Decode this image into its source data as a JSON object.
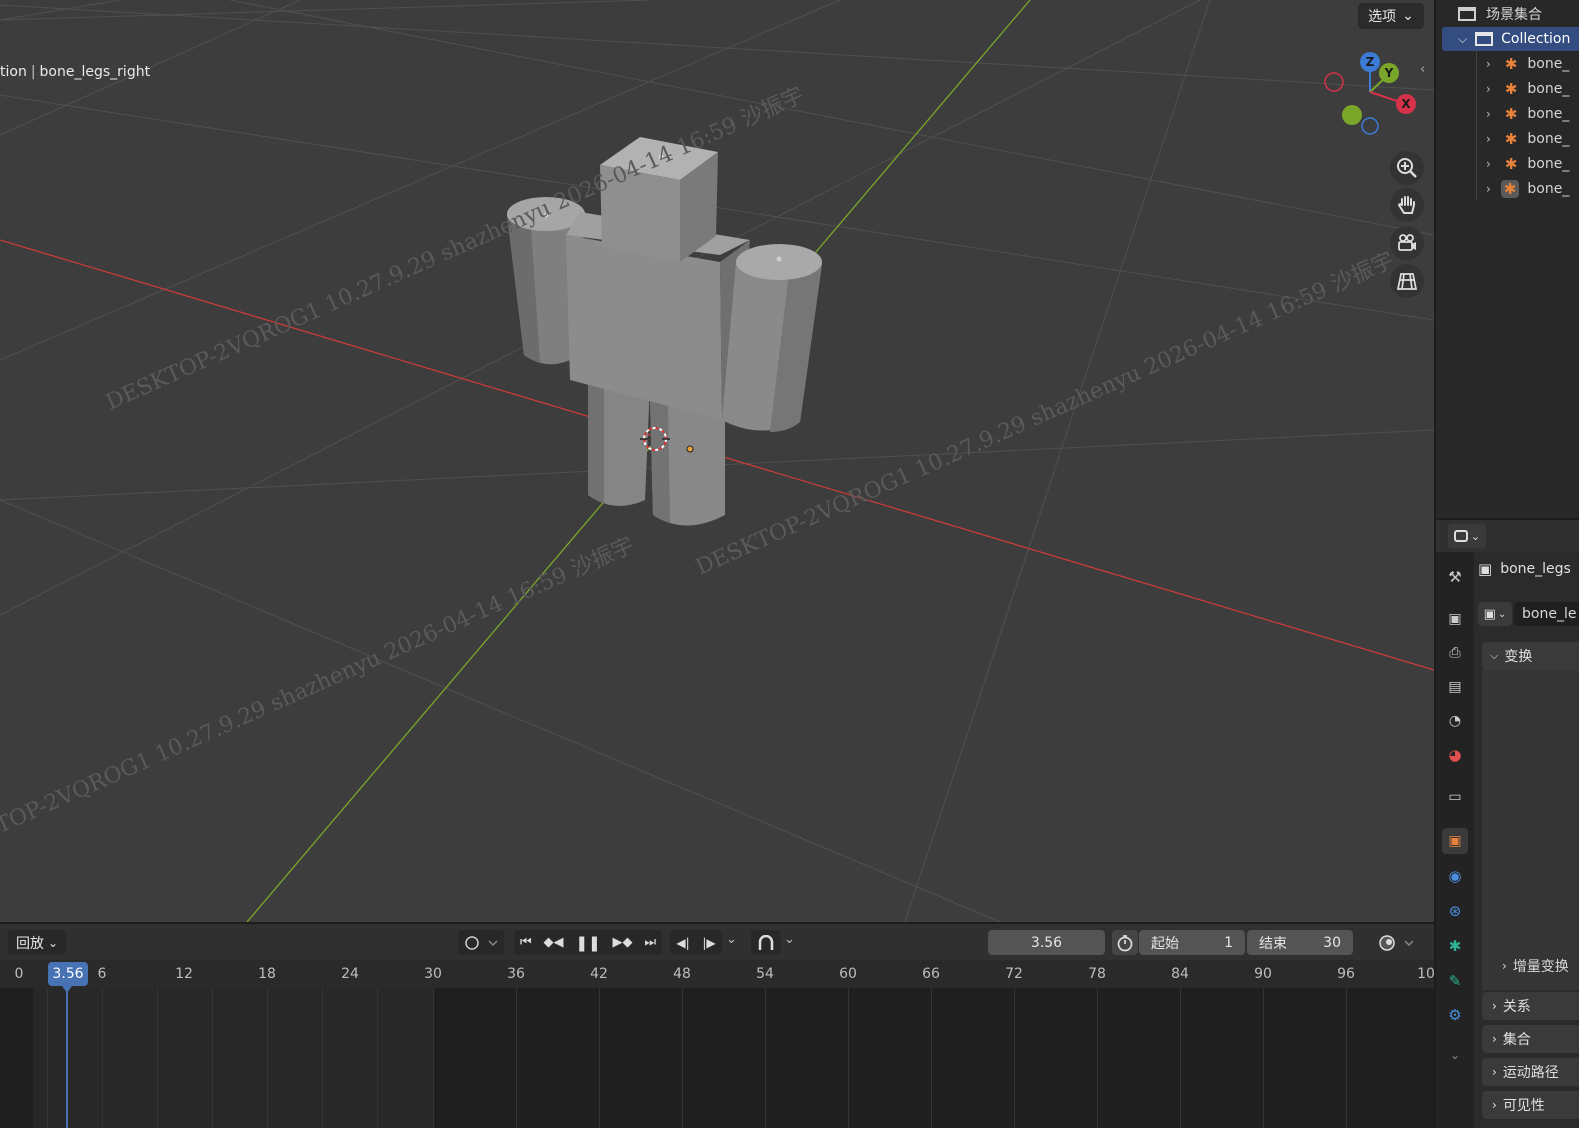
{
  "viewport": {
    "breadcrumb_left": "tion",
    "breadcrumb_object": "bone_legs_right",
    "options_label": "选项",
    "gizmo": {
      "z": "Z",
      "y": "Y",
      "x": "X"
    },
    "watermarks": [
      "DESKTOP-2VQROG1 10.27.9.29 shazhenyu 2026-04-14 16:59 沙振宇",
      "DESKTOP-2VQROG1 10.27.9.29 shazhenyu 2026-04-14 16:59 沙振宇",
      "DESKTOP-2VQROG1 10.27.9.29 shazhenyu 2026-04-14 16:59 沙振宇"
    ],
    "colors": {
      "x_axis": "#c83b3b",
      "y_axis": "#7aa62a",
      "background": "#3d3d3d"
    }
  },
  "timeline": {
    "playback_label": "回放",
    "current_frame": "3.56",
    "start_label": "起始",
    "start_value": "1",
    "end_label": "结束",
    "end_value": "30",
    "ruler_badge": "3.56",
    "ticks": [
      "0",
      "6",
      "12",
      "18",
      "24",
      "30",
      "36",
      "42",
      "48",
      "54",
      "60",
      "66",
      "72",
      "78",
      "84",
      "90",
      "96",
      "10"
    ]
  },
  "outliner": {
    "scene_collection": "场景集合",
    "collection": "Collection",
    "items": [
      "bone_",
      "bone_",
      "bone_",
      "bone_",
      "bone_",
      "bone_"
    ]
  },
  "properties": {
    "object_name": "bone_legs",
    "data_name": "bone_le",
    "transform_label": "变换",
    "delta_transform_label": "增量变换",
    "relations_label": "关系",
    "collections_label": "集合",
    "motion_paths_label": "运动路径",
    "visibility_label": "可见性",
    "accent_color": "#4772b3"
  }
}
